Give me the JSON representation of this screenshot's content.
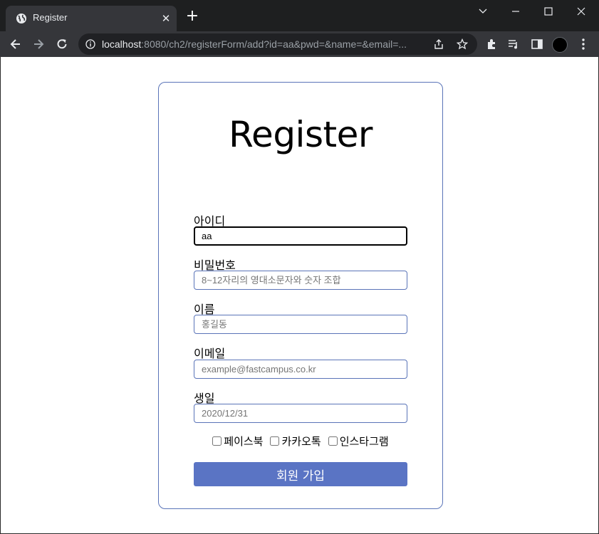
{
  "browser": {
    "tab_title": "Register",
    "tab_close": "✕",
    "new_tab": "+",
    "url_host": "localhost",
    "url_rest": ":8080/ch2/registerForm/add?id=aa&pwd=&name=&email=...",
    "profile_color": "#000000"
  },
  "form": {
    "title": "Register",
    "fields": [
      {
        "label": "아이디",
        "value": "aa",
        "placeholder": ""
      },
      {
        "label": "비밀번호",
        "value": "",
        "placeholder": "8~12자리의 영대소문자와 숫자 조합"
      },
      {
        "label": "이름",
        "value": "",
        "placeholder": "홍길동"
      },
      {
        "label": "이메일",
        "value": "",
        "placeholder": "example@fastcampus.co.kr"
      },
      {
        "label": "생일",
        "value": "",
        "placeholder": "2020/12/31"
      }
    ],
    "checkboxes": [
      {
        "label": "페이스북",
        "checked": false
      },
      {
        "label": "카카오톡",
        "checked": false
      },
      {
        "label": "인스타그램",
        "checked": false
      }
    ],
    "submit_label": "회원 가입",
    "accent_color": "#5a74c4"
  }
}
